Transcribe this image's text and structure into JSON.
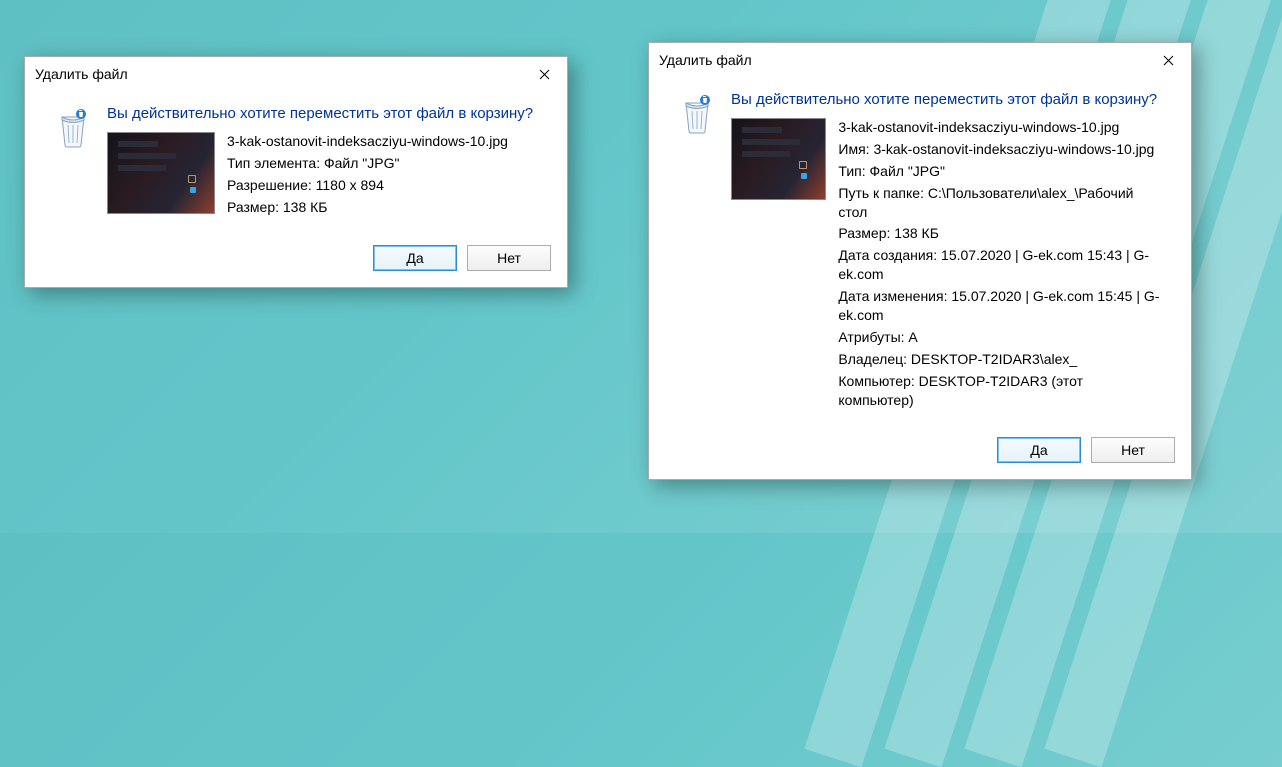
{
  "dialog1": {
    "title": "Удалить файл",
    "question": "Вы действительно хотите переместить этот файл в корзину?",
    "filename": "3-kak-ostanovit-indeksacziyu-windows-10.jpg",
    "type": "Тип элемента: Файл \"JPG\"",
    "resolution": "Разрешение: 1180 x 894",
    "size": "Размер: 138 КБ",
    "yes": "Да",
    "no": "Нет"
  },
  "dialog2": {
    "title": "Удалить файл",
    "question": "Вы действительно хотите переместить этот файл в корзину?",
    "filename": "3-kak-ostanovit-indeksacziyu-windows-10.jpg",
    "name": "Имя: 3-kak-ostanovit-indeksacziyu-windows-10.jpg",
    "type": "Тип: Файл \"JPG\"",
    "path": "Путь к папке: C:\\Пользователи\\alex_\\Рабочий стол",
    "size": "Размер: 138 КБ",
    "created": "Дата создания: 15.07.2020 | G-ek.com 15:43 | G-ek.com",
    "modified": "Дата изменения: 15.07.2020 | G-ek.com 15:45 | G-ek.com",
    "attributes": "Атрибуты: A",
    "owner": "Владелец: DESKTOP-T2IDAR3\\alex_",
    "computer": "Компьютер: DESKTOP-T2IDAR3 (этот компьютер)",
    "yes": "Да",
    "no": "Нет"
  }
}
